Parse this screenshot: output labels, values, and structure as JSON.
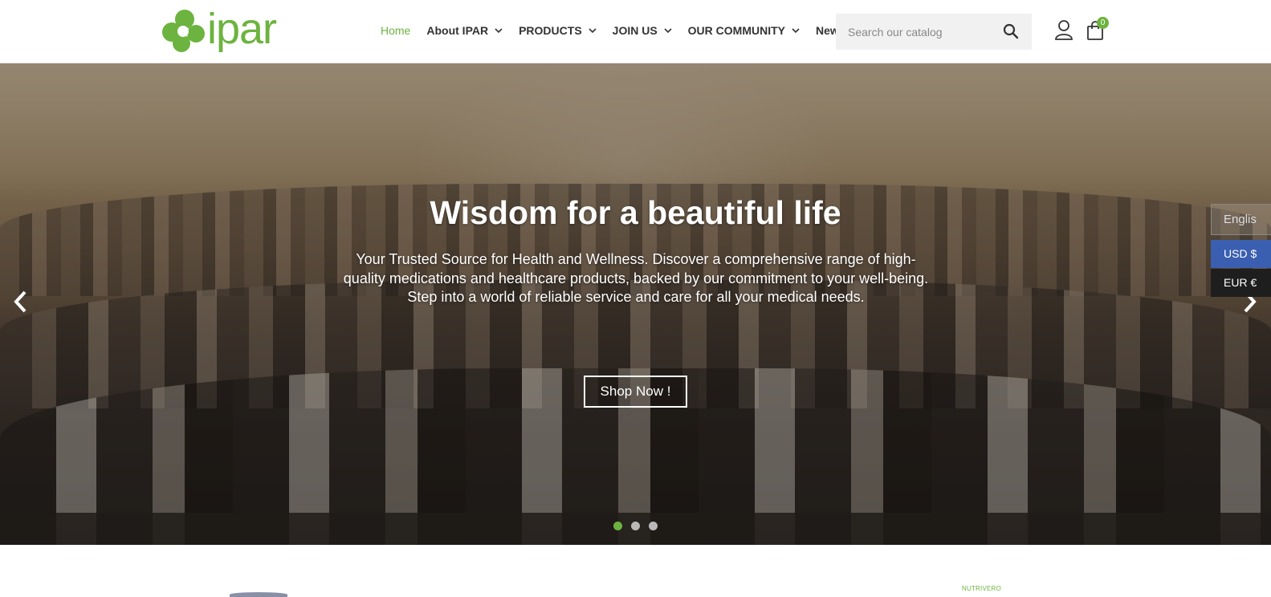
{
  "header": {
    "logo_text": "ipar",
    "nav": [
      {
        "label": "Home",
        "active": true,
        "dropdown": false
      },
      {
        "label": "About IPAR",
        "active": false,
        "dropdown": true
      },
      {
        "label": "PRODUCTS",
        "active": false,
        "dropdown": true
      },
      {
        "label": "JOIN US",
        "active": false,
        "dropdown": true
      },
      {
        "label": "OUR COMMUNITY",
        "active": false,
        "dropdown": true
      },
      {
        "label": "News",
        "active": false,
        "dropdown": false
      }
    ],
    "search": {
      "placeholder": "Search our catalog",
      "value": ""
    },
    "cart_count": "0",
    "icons": {
      "search": "search-icon",
      "user": "user-icon",
      "cart": "shopping-bag-icon"
    }
  },
  "hero": {
    "title": "Wisdom for a beautiful life",
    "text": "Your Trusted Source for Health and Wellness. Discover a comprehensive range of high-quality medications and healthcare products, backed by our commitment to your well-being. Step into a world of reliable service and care for all your medical needs.",
    "button_label": "Shop Now !",
    "slides": 3,
    "active_slide": 1
  },
  "language": {
    "label": "Englis"
  },
  "currencies": [
    {
      "label": "USD $",
      "active": true
    },
    {
      "label": "EUR €",
      "active": false
    }
  ],
  "below": {
    "brand_label": "NUTRIVERO"
  },
  "colors": {
    "accent": "#6db33f",
    "currency_active": "#3b5fb0",
    "currency_inactive": "#1e1e1e"
  }
}
